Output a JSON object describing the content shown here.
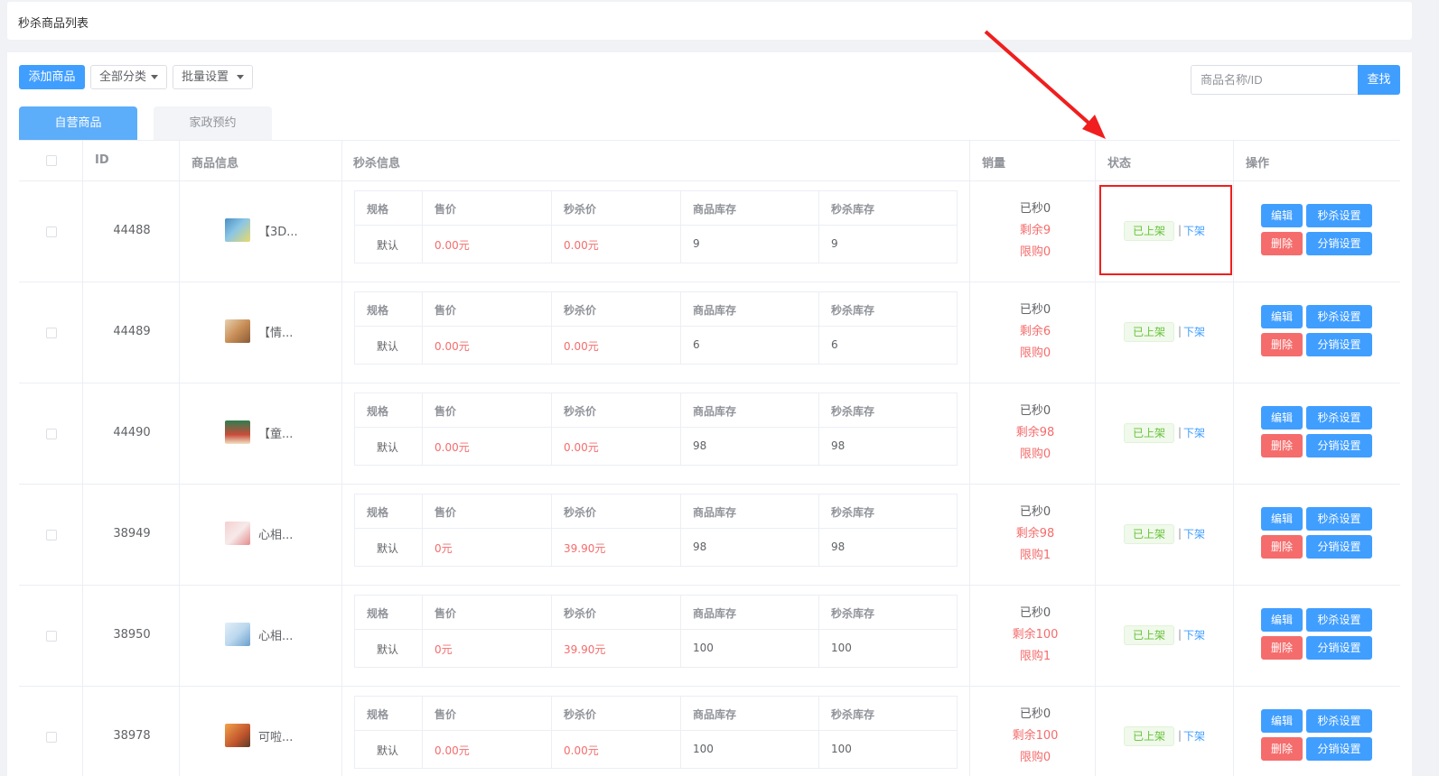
{
  "page": {
    "title": "秒杀商品列表"
  },
  "toolbar": {
    "add_label": "添加商品",
    "category_label": "全部分类",
    "batch_label": "批量设置",
    "search_placeholder": "商品名称/ID",
    "search_button": "查找"
  },
  "tabs": [
    {
      "label": "自营商品",
      "active": true
    },
    {
      "label": "家政预约",
      "active": false
    }
  ],
  "columns": [
    "ID",
    "商品信息",
    "秒杀信息",
    "销量",
    "状态",
    "操作"
  ],
  "inner_columns": [
    "规格",
    "售价",
    "秒杀价",
    "商品库存",
    "秒杀库存"
  ],
  "actions": {
    "edit": "编辑",
    "seckill": "秒杀设置",
    "delete": "删除",
    "distribution": "分销设置",
    "offline": "下架",
    "separator": "|"
  },
  "rows": [
    {
      "id": "44488",
      "name": "【3D...",
      "spec": "默认",
      "price": "0.00元",
      "seckill_price": "0.00元",
      "stock": "9",
      "seckill_stock": "9",
      "sold": "已秒0",
      "remaining": "剩余9",
      "limit": "限购0",
      "status": "已上架"
    },
    {
      "id": "44489",
      "name": "【情...",
      "spec": "默认",
      "price": "0.00元",
      "seckill_price": "0.00元",
      "stock": "6",
      "seckill_stock": "6",
      "sold": "已秒0",
      "remaining": "剩余6",
      "limit": "限购0",
      "status": "已上架"
    },
    {
      "id": "44490",
      "name": "【童...",
      "spec": "默认",
      "price": "0.00元",
      "seckill_price": "0.00元",
      "stock": "98",
      "seckill_stock": "98",
      "sold": "已秒0",
      "remaining": "剩余98",
      "limit": "限购0",
      "status": "已上架"
    },
    {
      "id": "38949",
      "name": "心相...",
      "spec": "默认",
      "price": "0元",
      "seckill_price": "39.90元",
      "stock": "98",
      "seckill_stock": "98",
      "sold": "已秒0",
      "remaining": "剩余98",
      "limit": "限购1",
      "status": "已上架"
    },
    {
      "id": "38950",
      "name": "心相...",
      "spec": "默认",
      "price": "0元",
      "seckill_price": "39.90元",
      "stock": "100",
      "seckill_stock": "100",
      "sold": "已秒0",
      "remaining": "剩余100",
      "limit": "限购1",
      "status": "已上架"
    },
    {
      "id": "38978",
      "name": "可啦...",
      "spec": "默认",
      "price": "0.00元",
      "seckill_price": "0.00元",
      "stock": "100",
      "seckill_stock": "100",
      "sold": "已秒0",
      "remaining": "剩余100",
      "limit": "限购0",
      "status": "已上架"
    }
  ],
  "colors": {
    "primary": "#409eff",
    "danger": "#f56c6c",
    "success": "#67c23a",
    "annotation": "#f01e1e"
  }
}
